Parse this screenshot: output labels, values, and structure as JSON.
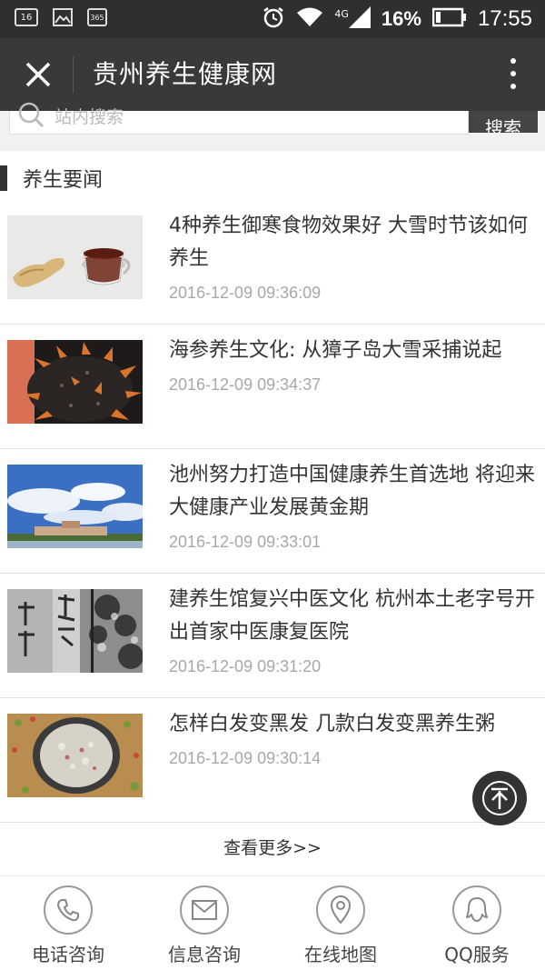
{
  "status_bar": {
    "left_icons": [
      "calendar-16-icon",
      "image-icon",
      "calendar-365-icon"
    ],
    "calendar_day": "16",
    "calendar_year": "365",
    "network": "4G",
    "battery": "16%",
    "time": "17:55"
  },
  "header": {
    "title": "贵州养生健康网"
  },
  "search": {
    "placeholder": "站内搜索",
    "button_label": "搜索"
  },
  "section": {
    "title": "养生要闻"
  },
  "news": [
    {
      "title": "4种养生御寒食物效果好 大雪时节该如何养生",
      "date": "2016-12-09 09:36:09"
    },
    {
      "title": "海参养生文化: 从獐子岛大雪采捕说起",
      "date": "2016-12-09 09:34:37"
    },
    {
      "title": "池州努力打造中国健康养生首选地 将迎来大健康产业发展黄金期",
      "date": "2016-12-09 09:33:01"
    },
    {
      "title": "建养生馆复兴中医文化 杭州本土老字号开出首家中医康复医院",
      "date": "2016-12-09 09:31:20"
    },
    {
      "title": "怎样白发变黑发 几款白发变黑养生粥",
      "date": "2016-12-09 09:30:14"
    }
  ],
  "more_link": "查看更多>>",
  "bottom_nav": [
    {
      "label": "电话咨询",
      "icon": "phone-icon"
    },
    {
      "label": "信息咨询",
      "icon": "mail-icon"
    },
    {
      "label": "在线地图",
      "icon": "map-pin-icon"
    },
    {
      "label": "QQ服务",
      "icon": "qq-icon"
    }
  ],
  "colors": {
    "status_bar": "#2f2f2f",
    "title_bar": "#393939",
    "accent": "#333333",
    "date_text": "#a8a8a8"
  }
}
